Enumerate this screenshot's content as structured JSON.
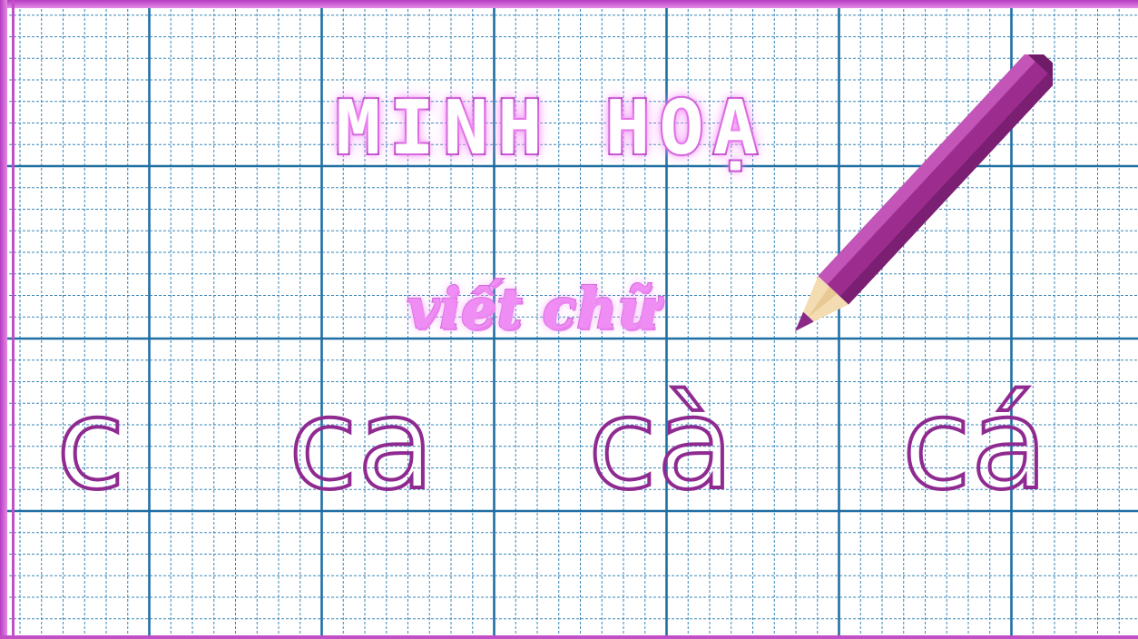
{
  "title": "MINH HOẠ",
  "subtitle": "viết chữ",
  "words": [
    "c",
    "ca",
    "cà",
    "cá"
  ],
  "colors": {
    "grid_major": "#1f6fa3",
    "grid_minor": "#3a87b8",
    "frame": "#c04fc8",
    "letters": "#8f2a91",
    "pencil": "#9c2d8f"
  },
  "icons": {
    "pencil": "pencil-icon"
  }
}
